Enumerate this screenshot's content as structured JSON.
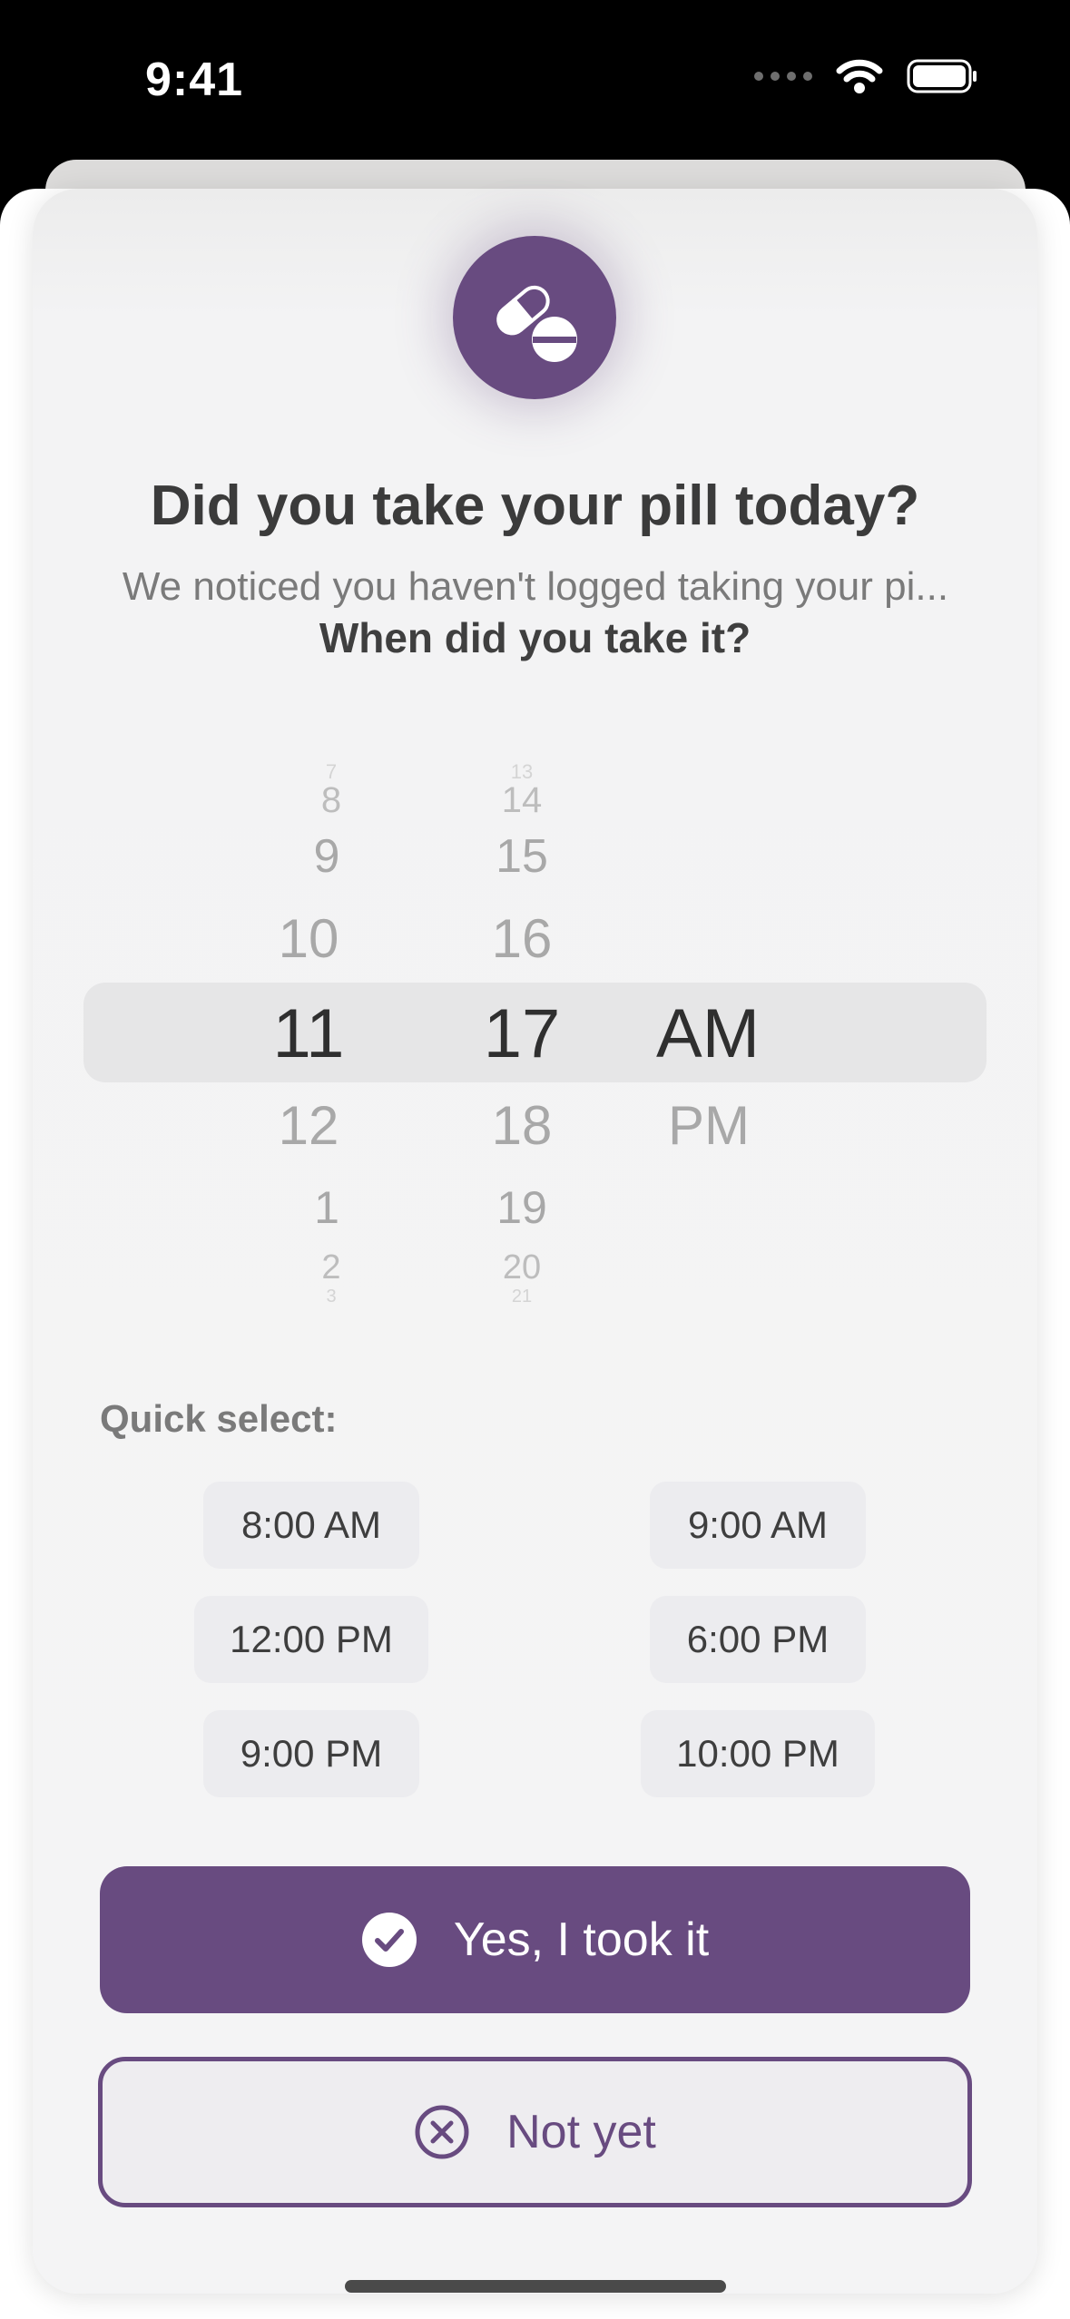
{
  "status_bar": {
    "time": "9:41"
  },
  "title": "Did you take your pill today?",
  "subtitle": "We noticed you haven't logged taking your pi...",
  "question": "When did you take it?",
  "picker": {
    "hours": [
      "7",
      "8",
      "9",
      "10",
      "11",
      "12",
      "1",
      "2",
      "3"
    ],
    "minutes": [
      "13",
      "14",
      "15",
      "16",
      "17",
      "18",
      "19",
      "20",
      "21"
    ],
    "periods": [
      "AM",
      "PM"
    ],
    "selected": {
      "hour": "11",
      "minute": "17",
      "period": "AM"
    }
  },
  "quick_select": {
    "label": "Quick select:",
    "options": [
      "8:00 AM",
      "9:00 AM",
      "12:00 PM",
      "6:00 PM",
      "9:00 PM",
      "10:00 PM"
    ]
  },
  "buttons": {
    "yes": "Yes, I took it",
    "not_yet": "Not yet"
  },
  "colors": {
    "accent": "#684b80",
    "text": "#3b3b3b",
    "secondary_text": "#7a7a7a"
  },
  "icons": {
    "header": "pill-icon",
    "yes": "checkmark-circle-icon",
    "no": "x-circle-icon"
  }
}
